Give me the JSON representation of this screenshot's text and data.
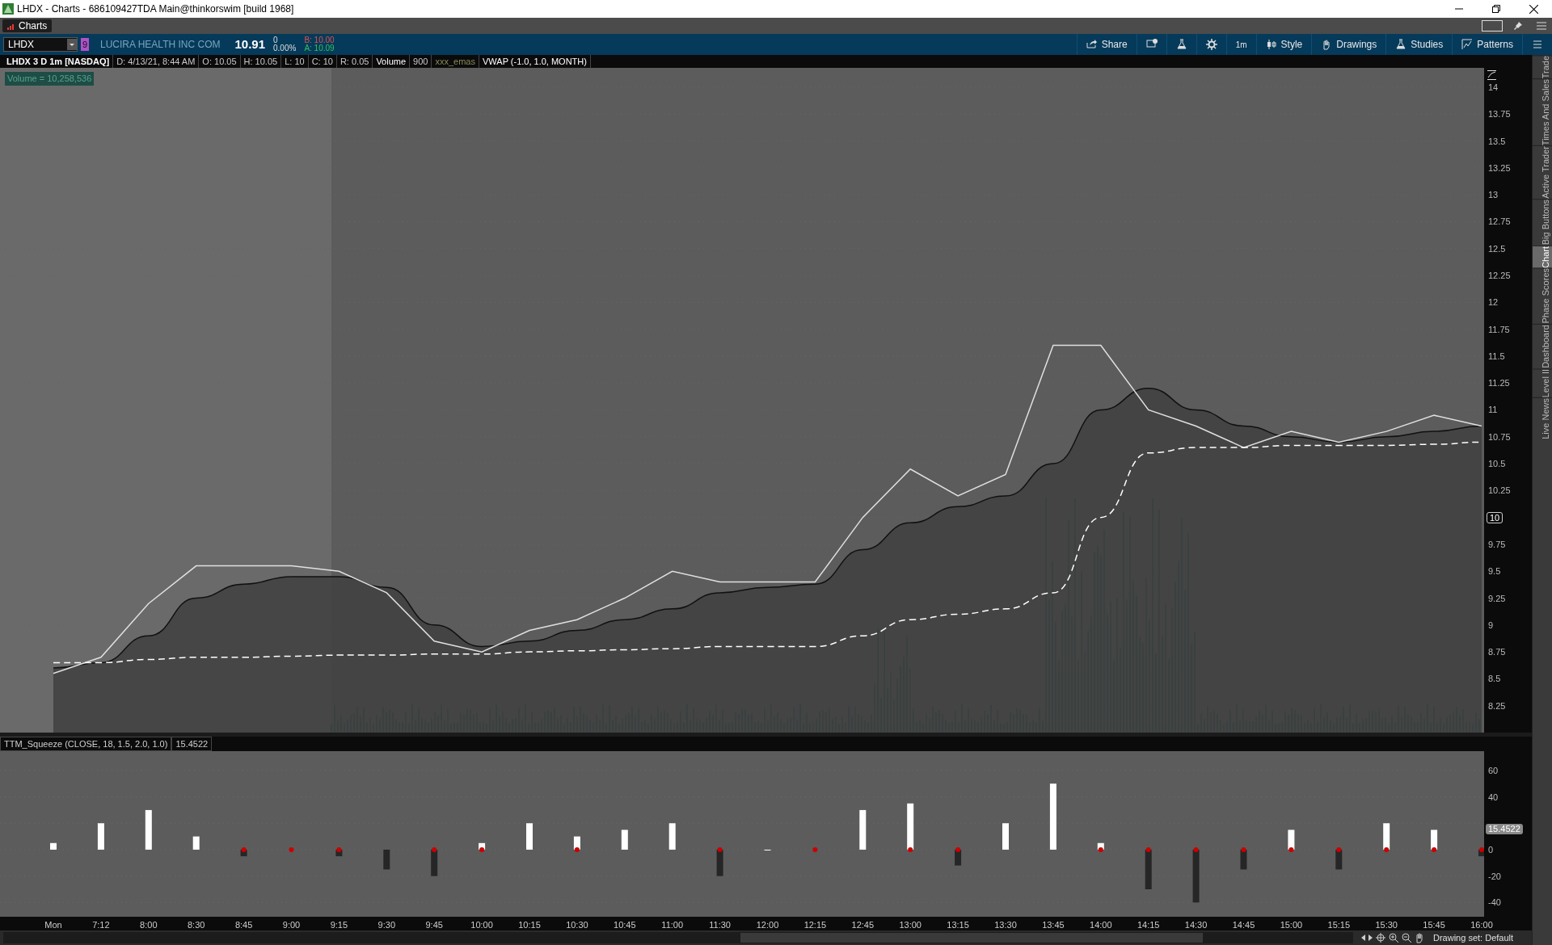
{
  "window": {
    "title": "LHDX - Charts - 686109427TDA Main@thinkorswim [build 1968]"
  },
  "tabs": [
    {
      "label": "Charts",
      "selected": true
    }
  ],
  "toolbar": {
    "symbol": "LHDX",
    "link_badge": "9",
    "company": "LUCIRA HEALTH INC COM",
    "last": "10.91",
    "change": "0",
    "change_pct": "0.00%",
    "bid": "B: 10.00",
    "ask": "A: 10.09",
    "buttons": [
      {
        "kind": "share",
        "label": "Share"
      },
      {
        "kind": "alert"
      },
      {
        "kind": "flask"
      },
      {
        "kind": "gear"
      },
      {
        "kind": "text",
        "label": "1m"
      },
      {
        "kind": "style",
        "label": "Style"
      },
      {
        "kind": "drawings",
        "label": "Drawings"
      },
      {
        "kind": "studies",
        "label": "Studies"
      },
      {
        "kind": "patterns",
        "label": "Patterns"
      },
      {
        "kind": "menu"
      }
    ]
  },
  "chart_header": [
    {
      "kind": "title",
      "text": "LHDX 3 D 1m [NASDAQ]"
    },
    {
      "kind": "info",
      "text": "D: 4/13/21, 8:44 AM"
    },
    {
      "kind": "info",
      "text": "O: 10.05"
    },
    {
      "kind": "info",
      "text": "H: 10.05"
    },
    {
      "kind": "info",
      "text": "L: 10"
    },
    {
      "kind": "info",
      "text": "C: 10"
    },
    {
      "kind": "info",
      "text": "R: 0.05"
    },
    {
      "kind": "study",
      "text": "Volume"
    },
    {
      "kind": "info",
      "text": "900"
    },
    {
      "kind": "muted",
      "text": "xxx_emas"
    },
    {
      "kind": "study",
      "text": "VWAP (-1.0, 1.0, MONTH)"
    }
  ],
  "volume_label": "Volume = 10,258,536",
  "price_chart": {
    "price_marker": "10",
    "chart_data": {
      "type": "line",
      "yticks": [
        8.25,
        8.5,
        8.75,
        9,
        9.25,
        9.5,
        9.75,
        10,
        10.25,
        10.5,
        10.75,
        11,
        11.25,
        11.5,
        11.75,
        12,
        12.25,
        12.5,
        12.75,
        13,
        13.25,
        13.5,
        13.75,
        14
      ],
      "ylim": [
        8,
        14.18
      ],
      "grid": true,
      "series": [
        {
          "type": "area",
          "color": "#111111",
          "values": [
            8.6,
            8.65,
            8.9,
            9.25,
            9.38,
            9.45,
            9.45,
            9.35,
            9.0,
            8.8,
            8.85,
            8.95,
            9.05,
            9.15,
            9.3,
            9.35,
            9.38,
            9.7,
            9.95,
            10.1,
            10.2,
            10.5,
            11.0,
            11.2,
            11.0,
            10.85,
            10.75,
            10.7,
            10.75,
            10.8,
            10.85
          ]
        },
        {
          "color": "#e0e0e0",
          "values": [
            8.55,
            8.7,
            9.2,
            9.55,
            9.55,
            9.55,
            9.5,
            9.3,
            8.85,
            8.75,
            8.95,
            9.05,
            9.25,
            9.5,
            9.4,
            9.4,
            9.4,
            10.0,
            10.45,
            10.2,
            10.4,
            11.6,
            11.6,
            11.0,
            10.85,
            10.65,
            10.8,
            10.7,
            10.8,
            10.95,
            10.85
          ]
        },
        {
          "color": "#ffffff",
          "line_style": "dashed",
          "values": [
            8.65,
            8.65,
            8.68,
            8.7,
            8.7,
            8.71,
            8.72,
            8.72,
            8.73,
            8.73,
            8.75,
            8.76,
            8.77,
            8.78,
            8.8,
            8.8,
            8.8,
            8.9,
            9.05,
            9.1,
            9.15,
            9.3,
            10.0,
            10.6,
            10.65,
            10.65,
            10.67,
            10.67,
            10.67,
            10.68,
            10.7
          ]
        }
      ]
    }
  },
  "squeeze_panel": {
    "header": "TTM_Squeeze (CLOSE, 18, 1.5, 2.0, 1.0)",
    "value": "15.4522",
    "value_marker": "15.4522",
    "chart_data": {
      "type": "bar",
      "categories": [
        "Mon",
        "7:12",
        "8:00",
        "8:30",
        "8:45",
        "9:00",
        "9:15",
        "9:30",
        "9:45",
        "10:00",
        "10:15",
        "10:30",
        "10:45",
        "11:00",
        "11:30",
        "12:00",
        "12:15",
        "12:45",
        "13:00",
        "13:15",
        "13:30",
        "13:45",
        "14:00",
        "14:15",
        "14:30",
        "14:45",
        "15:00",
        "15:15",
        "15:30",
        "15:45",
        "16:00"
      ],
      "yticks": [
        -40,
        -20,
        0,
        40,
        60
      ],
      "ylim": [
        -50.8,
        74.6
      ],
      "grid": true,
      "series": [
        {
          "color": "#ffffff",
          "values": [
            5,
            20,
            30,
            10,
            null,
            null,
            null,
            null,
            null,
            5,
            20,
            10,
            15,
            20,
            null,
            0,
            null,
            30,
            35,
            null,
            20,
            50,
            5,
            null,
            null,
            null,
            15,
            null,
            20,
            15,
            null
          ]
        },
        {
          "color": "#262626",
          "values": [
            null,
            null,
            null,
            null,
            -5,
            null,
            -5,
            -15,
            -20,
            null,
            null,
            null,
            null,
            null,
            -20,
            null,
            null,
            null,
            null,
            -12,
            null,
            null,
            null,
            -30,
            -40,
            -15,
            null,
            -15,
            null,
            null,
            -5
          ]
        },
        {
          "color": "#cc0000",
          "marker": "dot",
          "values": [
            null,
            null,
            null,
            null,
            0,
            0,
            0,
            null,
            0,
            0,
            null,
            0,
            null,
            null,
            0,
            null,
            0,
            null,
            0,
            0,
            null,
            null,
            0,
            0,
            0,
            0,
            0,
            0,
            0,
            0,
            0
          ]
        }
      ]
    }
  },
  "side_tabs": [
    {
      "label": "Trade",
      "selected": false
    },
    {
      "label": "Times And Sales",
      "selected": false
    },
    {
      "label": "Active Trader",
      "selected": false
    },
    {
      "label": "Big Buttons",
      "selected": false
    },
    {
      "label": "Chart",
      "selected": true
    },
    {
      "label": "Phase Scores",
      "selected": false
    },
    {
      "label": "Dashboard",
      "selected": false
    },
    {
      "label": "Level II",
      "selected": false
    },
    {
      "label": "Live News",
      "selected": false
    }
  ],
  "status": {
    "drawing_set": "Drawing set: Default"
  }
}
